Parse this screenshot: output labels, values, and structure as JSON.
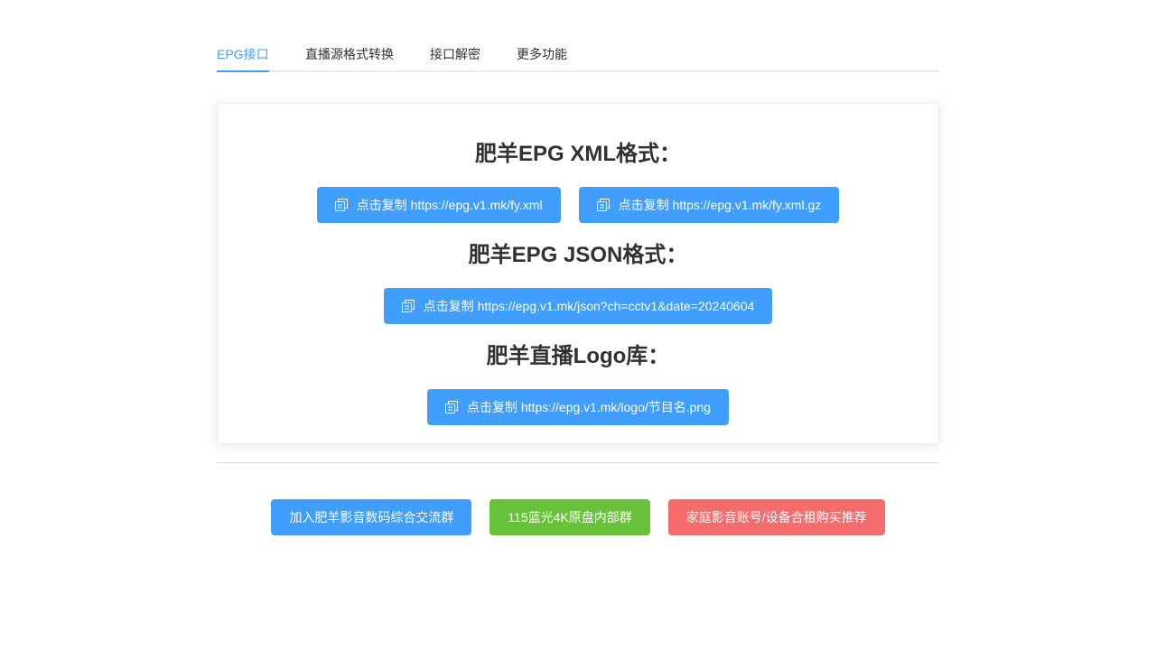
{
  "tabs": [
    {
      "label": "EPG接口",
      "active": true
    },
    {
      "label": "直播源格式转换",
      "active": false
    },
    {
      "label": "接口解密",
      "active": false
    },
    {
      "label": "更多功能",
      "active": false
    }
  ],
  "sections": [
    {
      "title": "肥羊EPG XML格式：",
      "buttons": [
        {
          "label": "点击复制 https://epg.v1.mk/fy.xml",
          "icon": "copy-icon"
        },
        {
          "label": "点击复制 https://epg.v1.mk/fy.xml.gz",
          "icon": "copy-icon"
        }
      ]
    },
    {
      "title": "肥羊EPG JSON格式：",
      "buttons": [
        {
          "label": "点击复制 https://epg.v1.mk/json?ch=cctv1&date=20240604",
          "icon": "copy-icon"
        }
      ]
    },
    {
      "title": "肥羊直播Logo库：",
      "buttons": [
        {
          "label": "点击复制 https://epg.v1.mk/logo/节目名.png",
          "icon": "copy-icon"
        }
      ]
    }
  ],
  "footer_buttons": [
    {
      "label": "加入肥羊影音数码综合交流群",
      "color": "#409eff"
    },
    {
      "label": "115蓝光4K原盘内部群",
      "color": "#67c23a"
    },
    {
      "label": "家庭影音账号/设备合租购买推荐",
      "color": "#f56c6c"
    }
  ],
  "colors": {
    "primary": "#409eff",
    "success": "#67c23a",
    "danger": "#f56c6c",
    "text": "#303133"
  }
}
